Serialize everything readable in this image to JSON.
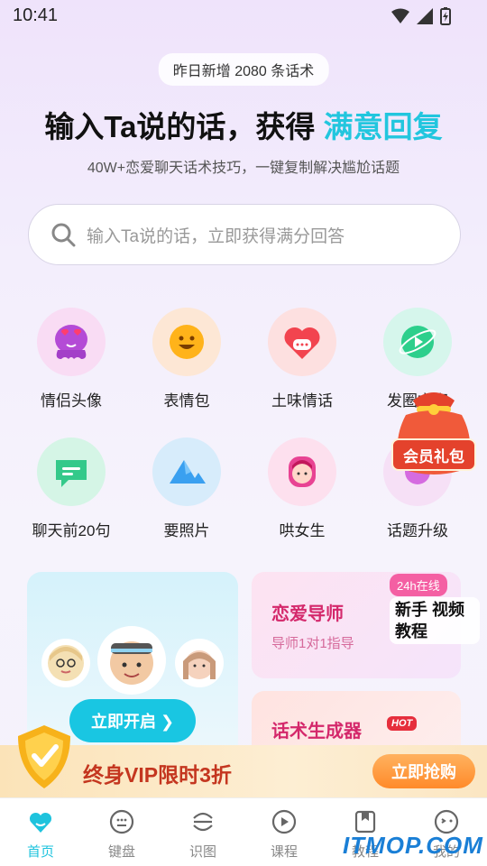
{
  "status": {
    "time": "10:41"
  },
  "banner": {
    "new_count": "昨日新增 2080 条话术"
  },
  "hero": {
    "title_main": "输入Ta说的话，获得 ",
    "title_highlight": "满意回复",
    "subtitle": "40W+恋爱聊天话术技巧，一键复制解决尴尬话题"
  },
  "search": {
    "placeholder": "输入Ta说的话，立即获得满分回答"
  },
  "features": [
    {
      "label": "情侣头像",
      "icon": "skull-hearts-icon",
      "bg": "#f9dcf4"
    },
    {
      "label": "表情包",
      "icon": "smiley-icon",
      "bg": "#fde7d5"
    },
    {
      "label": "土味情话",
      "icon": "heart-chat-icon",
      "bg": "#fde0e0"
    },
    {
      "label": "发圈文案",
      "icon": "planet-icon",
      "bg": "#d6f6ec"
    },
    {
      "label": "聊天前20句",
      "icon": "chat-bubble-icon",
      "bg": "#d5f5e6"
    },
    {
      "label": "要照片",
      "icon": "mountain-photo-icon",
      "bg": "#d7ecfb"
    },
    {
      "label": "哄女生",
      "icon": "girl-face-icon",
      "bg": "#fde0ee"
    },
    {
      "label": "话题升级",
      "icon": "topic-icon",
      "bg": "#f6e0f6"
    }
  ],
  "gift": {
    "label": "会员礼包"
  },
  "mentor_card": {
    "start_label": "立即开启 ❯"
  },
  "guide_card": {
    "title": "恋爱导师",
    "subtitle": "导师1对1指导",
    "online": "24h在线",
    "tutorial": "新手 视频教程"
  },
  "generator_card": {
    "title": "话术生成器",
    "hot": "HOT"
  },
  "vip": {
    "text": "终身VIP限时3折",
    "button": "立即抢购"
  },
  "tabs": [
    {
      "label": "首页",
      "icon": "home-heart-icon",
      "active": true
    },
    {
      "label": "键盘",
      "icon": "keyboard-face-icon",
      "active": false
    },
    {
      "label": "识图",
      "icon": "scan-icon",
      "active": false
    },
    {
      "label": "课程",
      "icon": "play-icon",
      "active": false
    },
    {
      "label": "教程",
      "icon": "bookmark-icon",
      "active": false
    },
    {
      "label": "我的",
      "icon": "profile-face-icon",
      "active": false
    }
  ],
  "watermark": "ITMOP.COM",
  "colors": {
    "accent": "#1ec3dd",
    "pink": "#d4286b",
    "vip_red": "#c4361f"
  }
}
